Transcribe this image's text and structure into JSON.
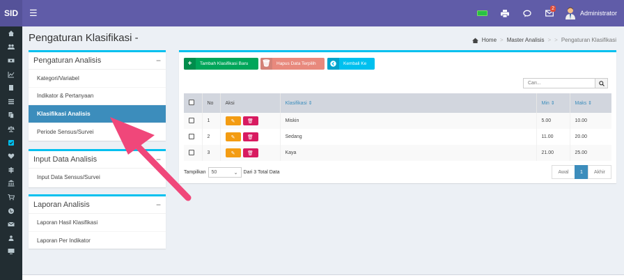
{
  "app": {
    "brand": "SID"
  },
  "topbar": {
    "notif_count": "2",
    "user_name": "Administrator"
  },
  "header": {
    "title": "Pengaturan Klasifikasi -"
  },
  "breadcrumb": {
    "home": "Home",
    "master": "Master Analisis",
    "current": "Pengaturan Klasifikasi"
  },
  "boxes": [
    {
      "title": "Pengaturan Analisis",
      "items": [
        "Kategori/Variabel",
        "Indikator & Pertanyaan",
        "Klasifikasi Analisis",
        "Periode Sensus/Survei"
      ]
    },
    {
      "title": "Input Data Analisis",
      "items": [
        "Input Data Sensus/Survei"
      ]
    },
    {
      "title": "Laporan Analisis",
      "items": [
        "Laporan Hasil Klasifikasi",
        "Laporan Per Indikator"
      ]
    }
  ],
  "toolbar": {
    "add_label": "Tambah Klasifikasi Baru",
    "delete_label": "Hapus Data Terpilih",
    "back_label": "Kembali Ke"
  },
  "search": {
    "placeholder": "Cari..."
  },
  "table": {
    "headers": {
      "no": "No",
      "aksi": "Aksi",
      "klasifikasi": "Klasifikasi",
      "min": "Min",
      "maks": "Maks"
    },
    "rows": [
      {
        "no": "1",
        "klasifikasi": "Miskin",
        "min": "5.00",
        "maks": "10.00"
      },
      {
        "no": "2",
        "klasifikasi": "Sedang",
        "min": "11.00",
        "maks": "20.00"
      },
      {
        "no": "3",
        "klasifikasi": "Kaya",
        "min": "21.00",
        "maks": "25.00"
      }
    ]
  },
  "footer": {
    "show_label": "Tampilkan",
    "page_size": "50",
    "total_label": "Dari 3 Total Data"
  },
  "pagination": {
    "first": "Awal",
    "current": "1",
    "last": "Akhir"
  },
  "colors": {
    "navbar": "#605ca8",
    "sidebar": "#222d32",
    "accent": "#00c0ef",
    "active": "#3c8dbc",
    "arrow": "#f0477a"
  }
}
